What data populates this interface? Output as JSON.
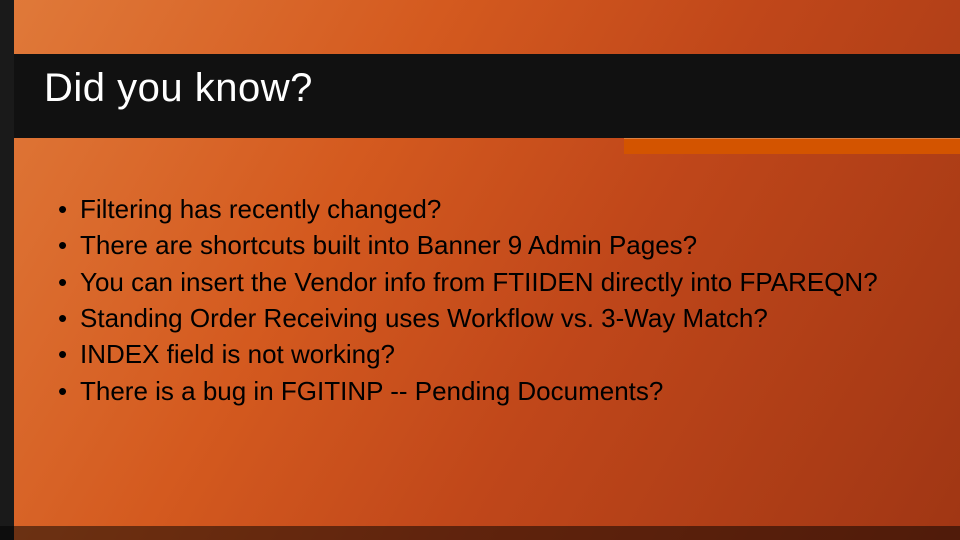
{
  "title": "Did you know?",
  "bullets": [
    "Filtering has recently changed?",
    "There are shortcuts built into Banner 9 Admin Pages?",
    "You can insert the Vendor info from FTIIDEN directly into FPAREQN?",
    "Standing Order Receiving uses Workflow vs. 3-Way Match?",
    "INDEX field is not working?",
    "There is a bug in FGITINP -- Pending Documents?"
  ]
}
